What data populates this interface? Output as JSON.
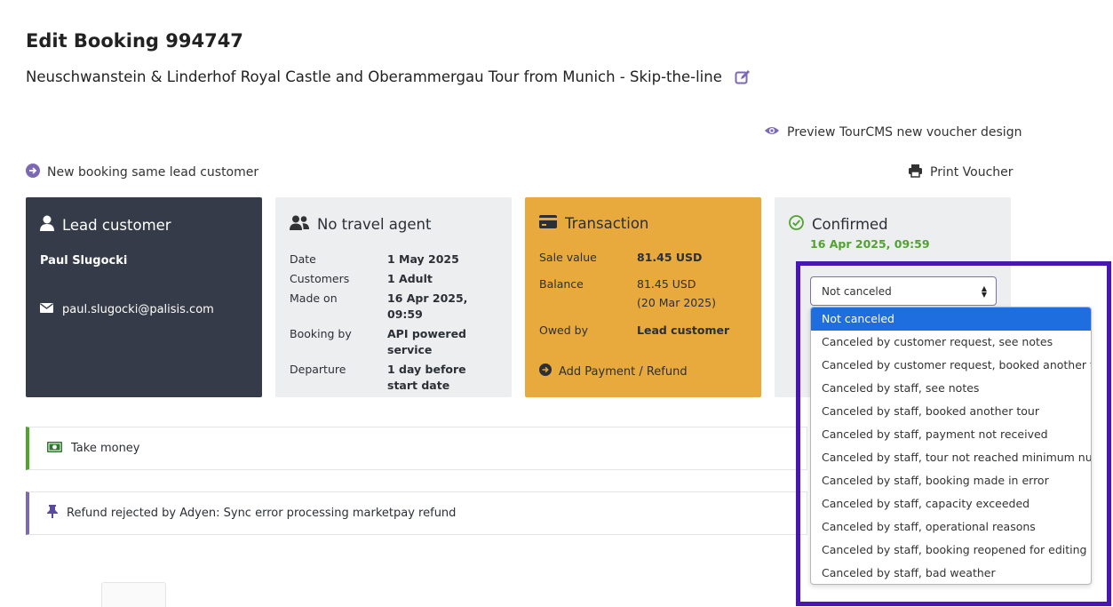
{
  "header": {
    "title": "Edit Booking 994747",
    "subtitle": "Neuschwanstein & Linderhof Royal Castle and Oberammergau Tour from Munich - Skip-the-line"
  },
  "links": {
    "preview": "Preview TourCMS new voucher design",
    "new_booking": "New booking same lead customer",
    "print": "Print Voucher"
  },
  "lead_card": {
    "title": "Lead customer",
    "name": "Paul Slugocki",
    "email": "paul.slugocki@palisis.com"
  },
  "agent_card": {
    "title": "No travel agent",
    "rows": [
      {
        "key": "Date",
        "value": "1 May 2025"
      },
      {
        "key": "Customers",
        "value": "1 Adult"
      },
      {
        "key": "Made on",
        "value": "16 Apr 2025, 09:59"
      },
      {
        "key": "Booking by",
        "value": "API powered service"
      },
      {
        "key": "Departure",
        "value": "1 day before start date"
      }
    ]
  },
  "txn_card": {
    "title": "Transaction",
    "sale_value_label": "Sale value",
    "sale_value": "81.45 USD",
    "balance_label": "Balance",
    "balance": "81.45 USD",
    "balance_date": "(20 Mar 2025)",
    "owed_by_label": "Owed by",
    "owed_by": "Lead customer",
    "add_payment": "Add Payment / Refund"
  },
  "status_card": {
    "title": "Confirmed",
    "date": "16 Apr 2025, 09:59",
    "select_value": "Not canceled"
  },
  "cancel_options": [
    "Not canceled",
    "Canceled by customer request, see notes",
    "Canceled by customer request, booked another tour",
    "Canceled by staff, see notes",
    "Canceled by staff, booked another tour",
    "Canceled by staff, payment not received",
    "Canceled by staff, tour not reached minimum numbers",
    "Canceled by staff, booking made in error",
    "Canceled by staff, capacity exceeded",
    "Canceled by staff, operational reasons",
    "Canceled by staff, booking reopened for editing",
    "Canceled by staff, bad weather"
  ],
  "alerts": {
    "take_money": "Take money",
    "refund_rejected": "Refund rejected by Adyen: Sync error processing marketpay refund"
  },
  "colors": {
    "lead_card_bg": "#353b48",
    "txn_card_bg": "#e8aa3c",
    "accent_purple": "#7d68b5",
    "confirmed_green": "#4fa32e",
    "highlight": "#4a16b3",
    "selected_option": "#1f6ee0"
  }
}
